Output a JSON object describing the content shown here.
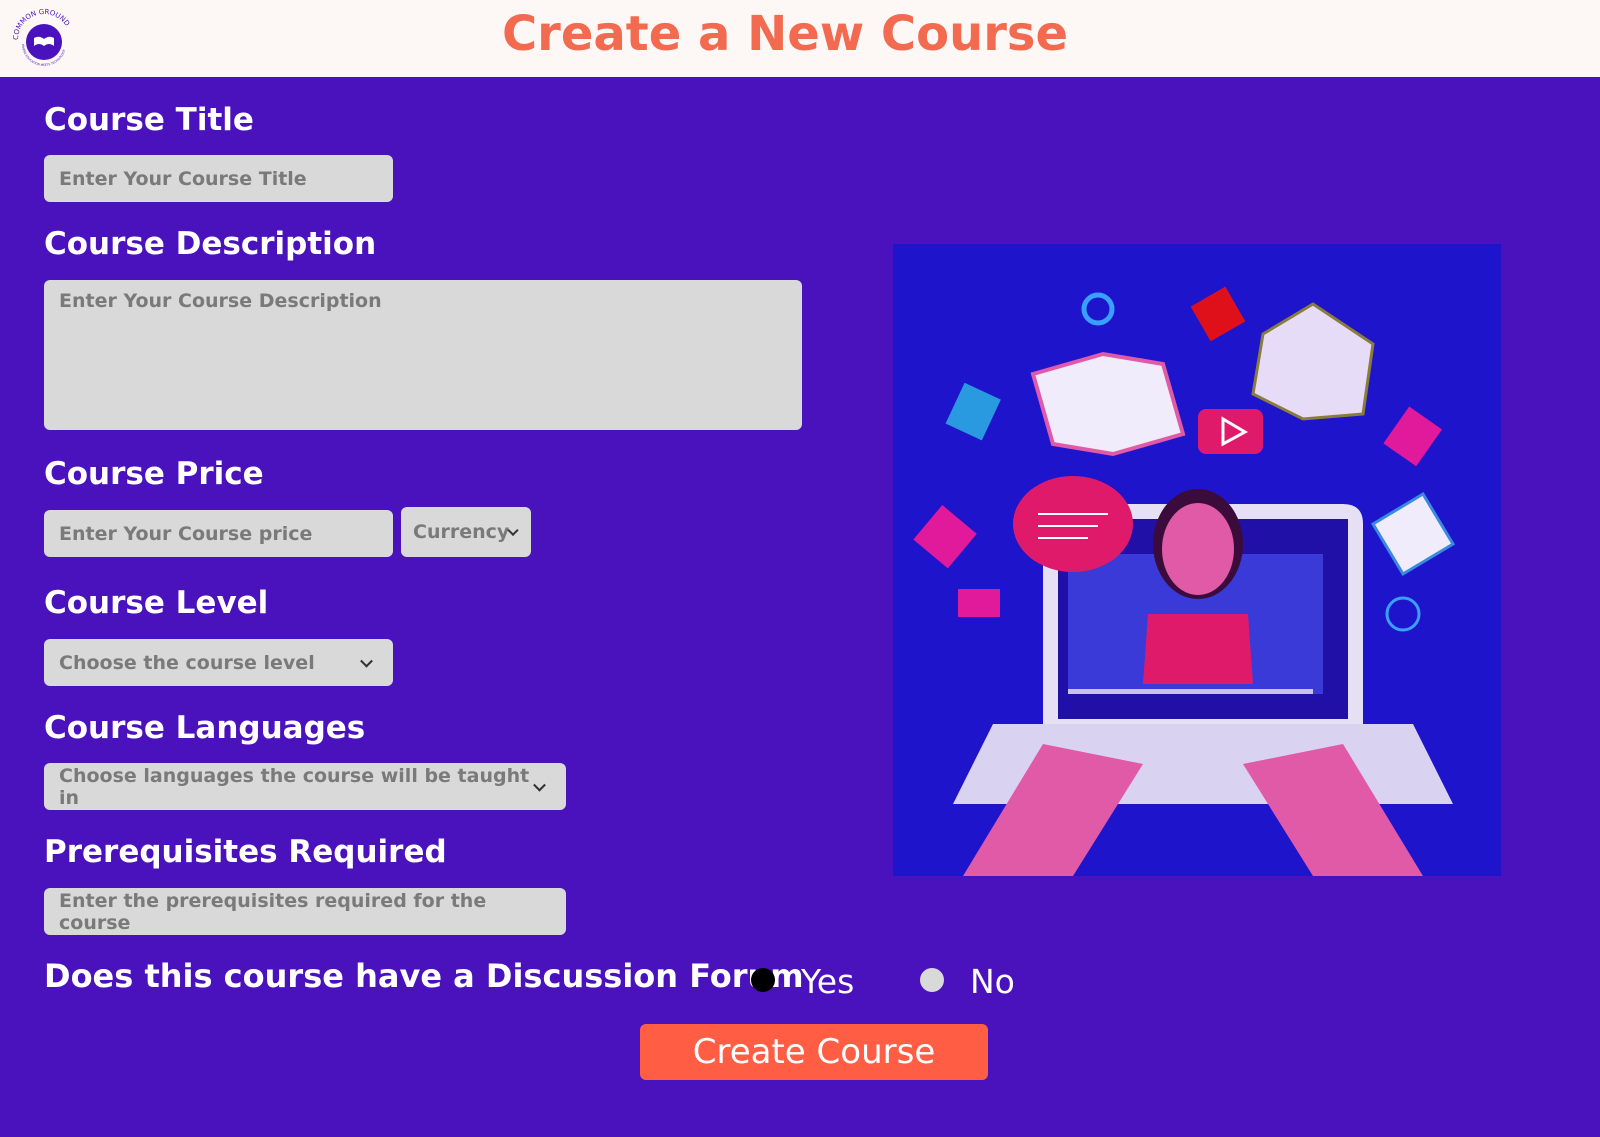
{
  "header": {
    "title": "Create a New Course",
    "logo_text": "COMMON GROUND",
    "logo_tagline": "WHERE EDUCATION MEETS TECHNOLOGY"
  },
  "form": {
    "title": {
      "label": "Course Title",
      "placeholder": "Enter Your Course Title"
    },
    "description": {
      "label": "Course Description",
      "placeholder": "Enter Your Course Description"
    },
    "price": {
      "label": "Course Price",
      "placeholder": "Enter Your Course price",
      "currency": "Currency"
    },
    "level": {
      "label": "Course Level",
      "selected": "Choose the course level"
    },
    "languages": {
      "label": "Course Languages",
      "selected": "Choose languages the course will be taught in"
    },
    "prerequisites": {
      "label": "Prerequisites Required",
      "placeholder": "Enter the prerequisites required for the course"
    },
    "forum": {
      "label": "Does this course have a Discussion Forum",
      "yes": "Yes",
      "no": "No",
      "selected": "Yes"
    },
    "submit": "Create Course"
  },
  "colors": {
    "background": "#4a12bd",
    "accent": "#ff5e45",
    "title": "#f26a4f"
  }
}
